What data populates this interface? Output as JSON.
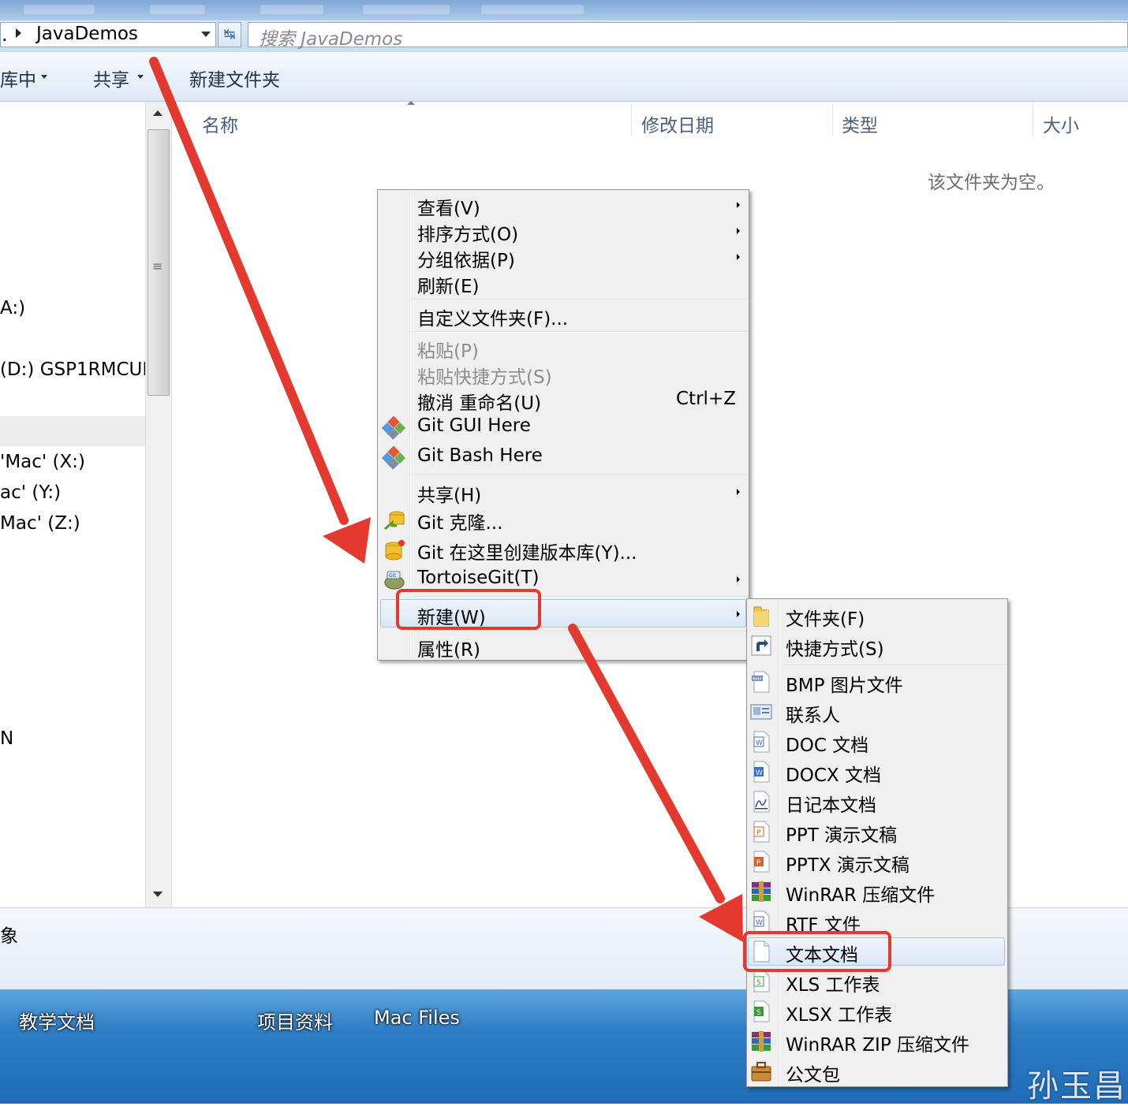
{
  "address_bar": {
    "prefix": ".",
    "path": "JavaDemos"
  },
  "search": {
    "placeholder": "搜索 JavaDemos"
  },
  "toolbar": {
    "library": "库中",
    "share": "共享",
    "new_folder": "新建文件夹"
  },
  "nav": {
    "items": [
      "A:)",
      "(D:) GSP1RMCUI",
      "'Mac' (X:)",
      "ac' (Y:)",
      "Mac' (Z:)",
      "N"
    ]
  },
  "columns": {
    "name": "名称",
    "modified": "修改日期",
    "type": "类型",
    "size": "大小"
  },
  "empty_message": "该文件夹为空。",
  "status": {
    "text": "象"
  },
  "taskbar": {
    "items": [
      "教学文档",
      "项目资料",
      "Mac Files"
    ]
  },
  "watermark": "孙玉昌",
  "context_menu": {
    "view": "查看(V)",
    "sort": "排序方式(O)",
    "group": "分组依据(P)",
    "refresh": "刷新(E)",
    "customize": "自定义文件夹(F)...",
    "paste": "粘贴(P)",
    "paste_shortcut": "粘贴快捷方式(S)",
    "undo": "撤消 重命名(U)",
    "undo_shortcut": "Ctrl+Z",
    "git_gui": "Git GUI Here",
    "git_bash": "Git Bash Here",
    "share": "共享(H)",
    "git_clone": "Git 克隆...",
    "git_create": "Git 在这里创建版本库(Y)...",
    "tortoise": "TortoiseGit(T)",
    "new": "新建(W)",
    "properties": "属性(R)"
  },
  "new_submenu": {
    "folder": "文件夹(F)",
    "shortcut": "快捷方式(S)",
    "bmp": "BMP 图片文件",
    "contact": "联系人",
    "doc": "DOC 文档",
    "docx": "DOCX 文档",
    "journal": "日记本文档",
    "ppt": "PPT 演示文稿",
    "pptx": "PPTX 演示文稿",
    "winrar": "WinRAR 压缩文件",
    "rtf": "RTF 文件",
    "text": "文本文档",
    "xls": "XLS 工作表",
    "xlsx": "XLSX 工作表",
    "winrar_zip": "WinRAR ZIP 压缩文件",
    "briefcase": "公文包"
  },
  "colors": {
    "annotation_red": "#e3392f",
    "menu_bg": "#f0f0f0",
    "highlight": "#dbe8f6"
  }
}
